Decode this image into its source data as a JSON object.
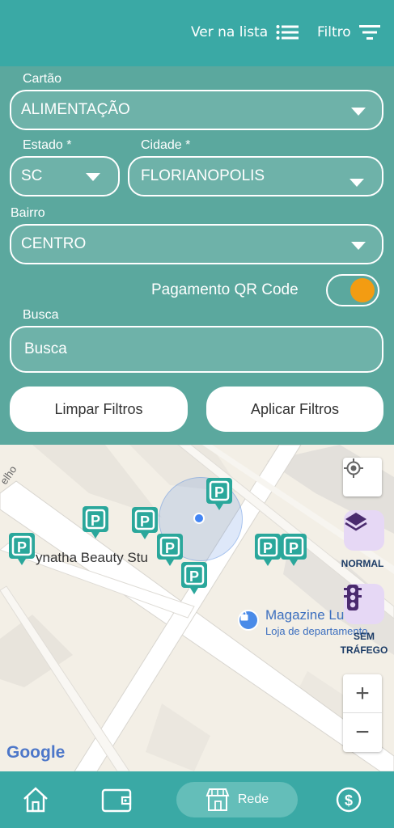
{
  "header": {
    "list_label": "Ver na lista",
    "filter_label": "Filtro"
  },
  "filters": {
    "card_label": "Cartão",
    "card_value": "ALIMENTAÇÃO",
    "state_label": "Estado *",
    "state_value": "SC",
    "city_label": "Cidade *",
    "city_value": "FLORIANOPOLIS",
    "district_label": "Bairro",
    "district_value": "CENTRO",
    "qr_label": "Pagamento QR Code",
    "qr_enabled": true,
    "search_label": "Busca",
    "search_placeholder": "Busca",
    "clear_label": "Limpar Filtros",
    "apply_label": "Aplicar Filtros"
  },
  "map": {
    "street_fragment": "elho",
    "place1": "ynatha Beauty Stu",
    "place2_title": "Magazine Lu",
    "place2_subtitle": "Loja de departamento",
    "map_type": "NORMAL",
    "traffic_label_line1": "SEM",
    "traffic_label_line2": "TRÁFEGO",
    "zoom_in": "+",
    "zoom_out": "−",
    "google_logo": "Google"
  },
  "nav": {
    "active_label": "Rede"
  },
  "colors": {
    "primary": "#3aa9a5",
    "filter_bg": "#5ba89e",
    "toggle_knob": "#f39c12",
    "pin": "#2aa79b"
  }
}
